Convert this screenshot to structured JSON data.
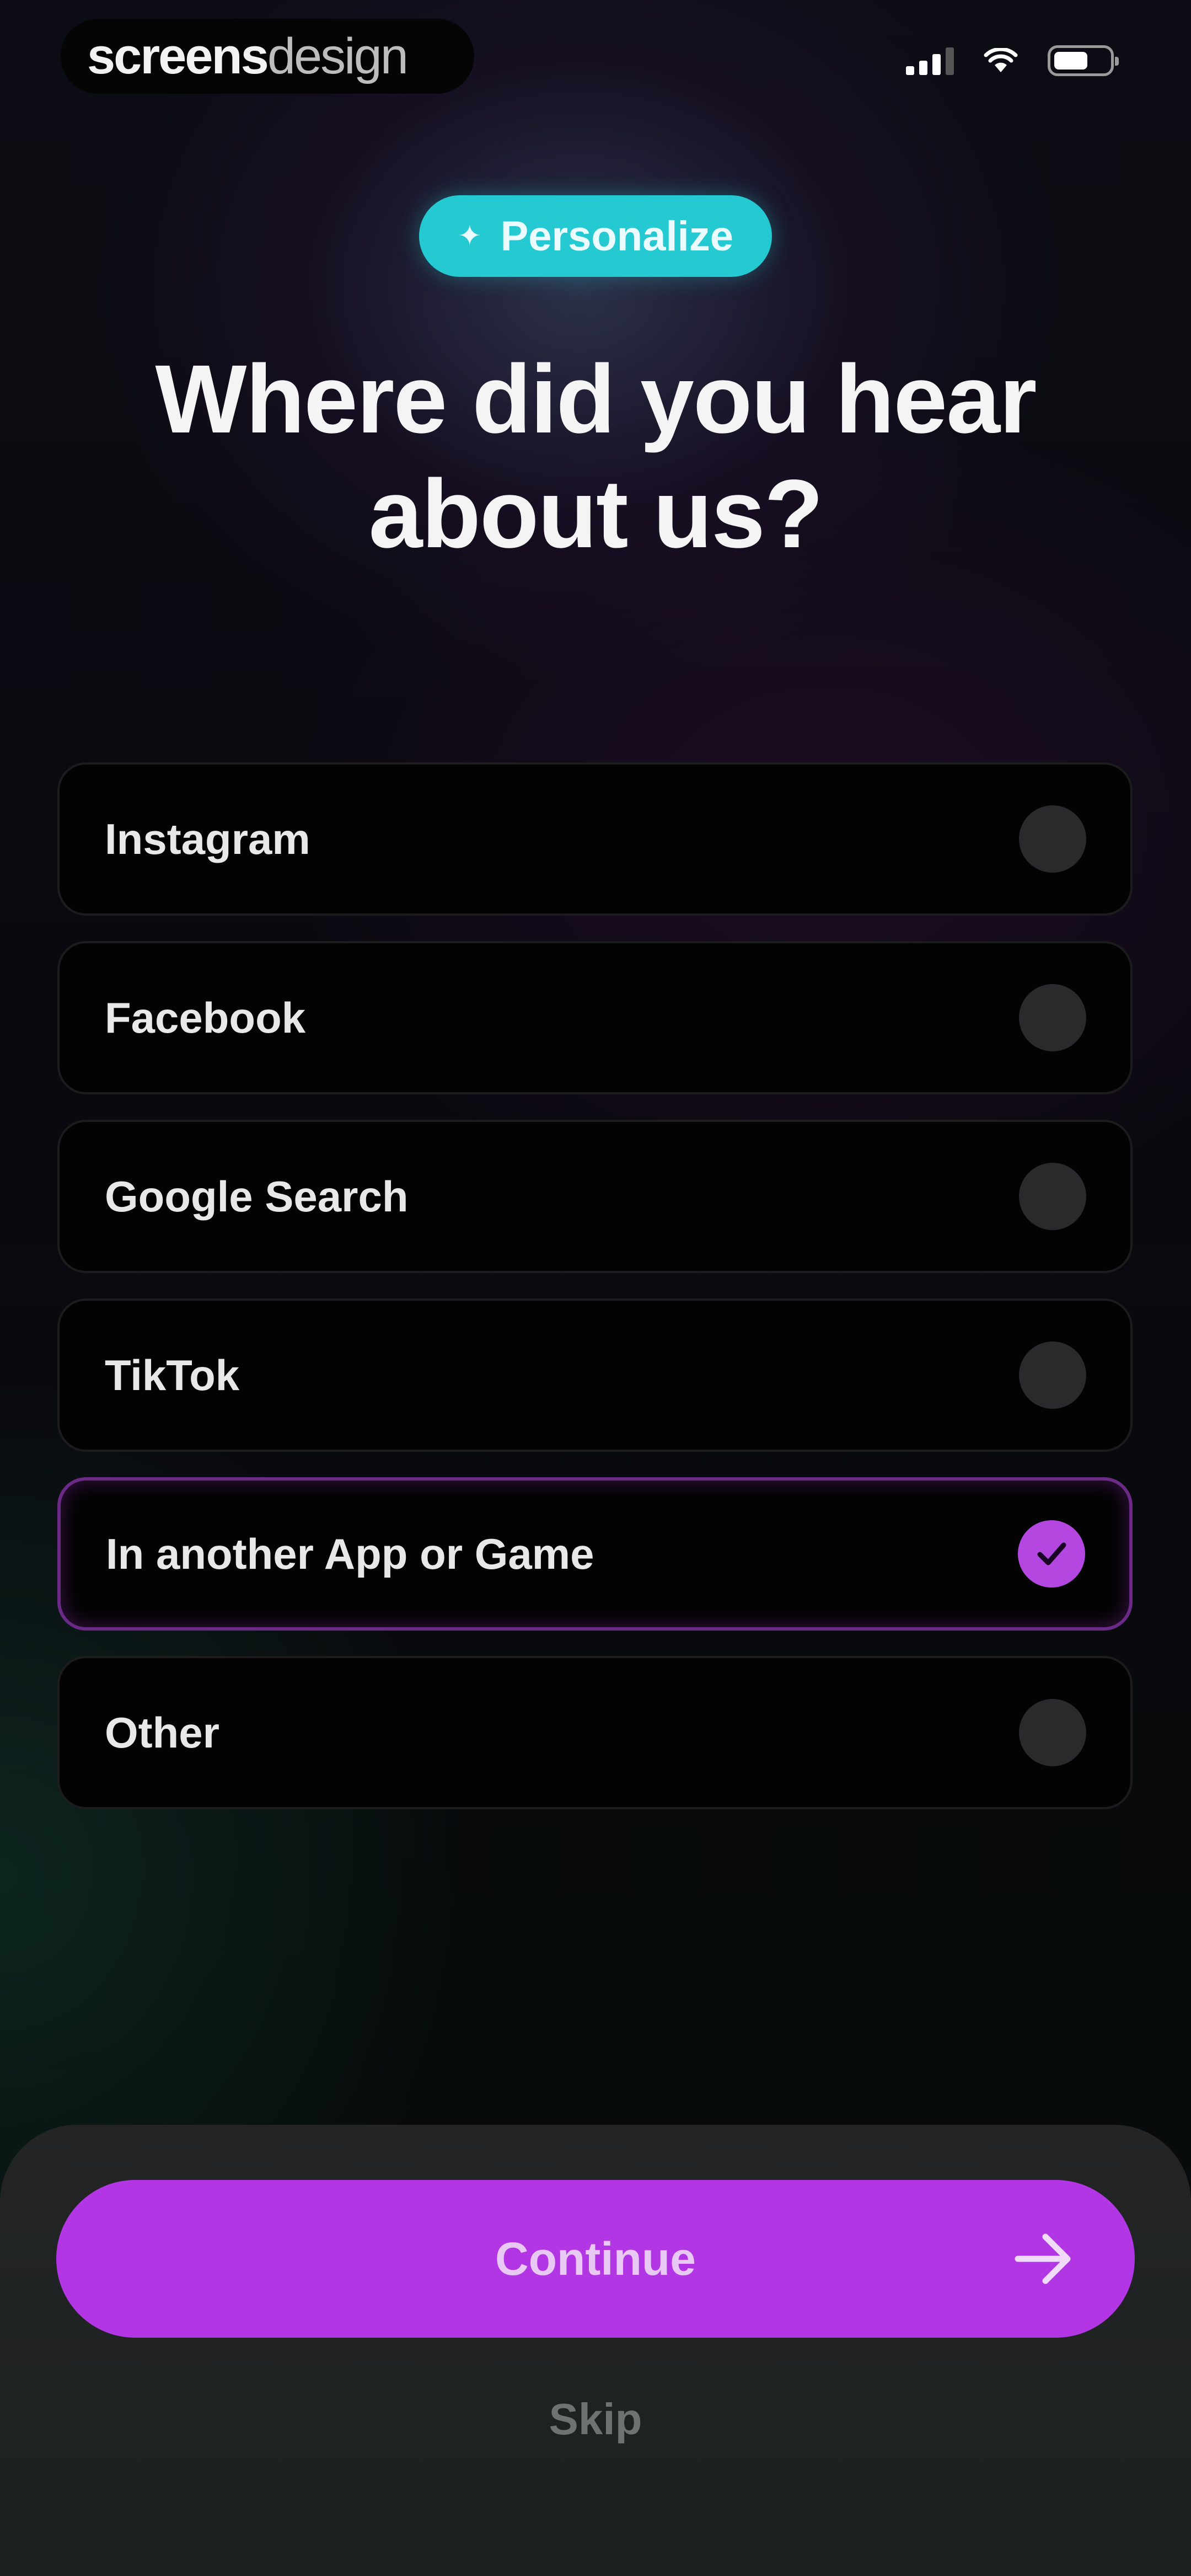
{
  "status_bar": {
    "brand_bold": "screens",
    "brand_light": "design",
    "signal_icon": "signal-icon",
    "wifi_icon": "wifi-icon",
    "battery_icon": "battery-icon",
    "battery_level": 0.62
  },
  "chip": {
    "icon": "sparkle-icon",
    "label": "Personalize"
  },
  "title": {
    "line1": "Where did you hear",
    "line2": "about us?"
  },
  "options": [
    {
      "label": "Instagram",
      "selected": false
    },
    {
      "label": "Facebook",
      "selected": false
    },
    {
      "label": "Google Search",
      "selected": false
    },
    {
      "label": "TikTok",
      "selected": false
    },
    {
      "label": "In another App or Game",
      "selected": true
    },
    {
      "label": "Other",
      "selected": false
    }
  ],
  "actions": {
    "continue_label": "Continue",
    "continue_icon": "arrow-right-icon",
    "skip_label": "Skip"
  },
  "colors": {
    "accent": "#b236e4",
    "chip": "#25c9d2",
    "selected_border": "#6a2a86"
  }
}
